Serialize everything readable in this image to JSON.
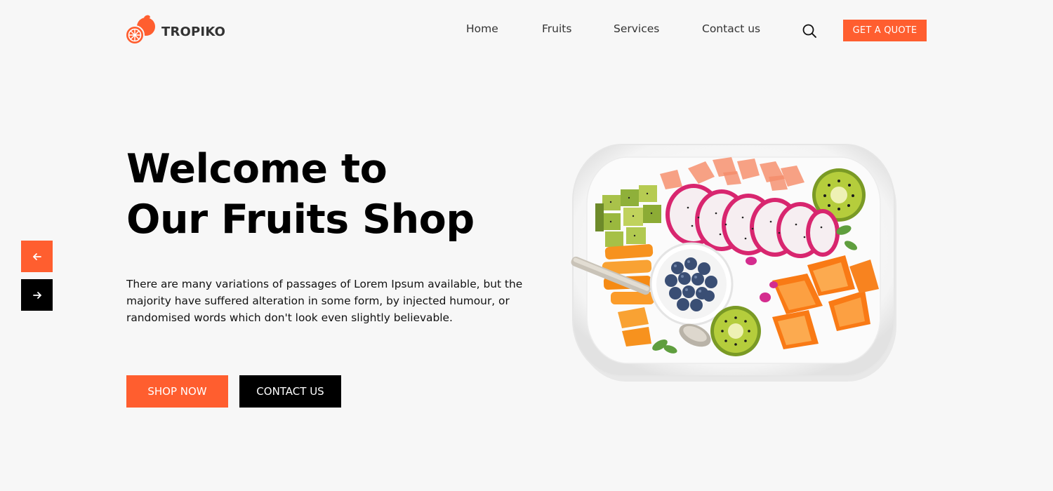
{
  "brand": {
    "name": "TROPIKO",
    "logo_icon": "orange-fruit-icon",
    "accent_color": "#ff5e2f"
  },
  "nav": {
    "items": [
      {
        "label": "Home"
      },
      {
        "label": "Fruits"
      },
      {
        "label": "Services"
      },
      {
        "label": "Contact us"
      }
    ],
    "search_icon": "search-icon",
    "quote_button": "GET A QUOTE"
  },
  "hero": {
    "title_line1": "Welcome to",
    "title_line2": "Our Fruits Shop",
    "description": "There are many variations of passages of Lorem Ipsum available, but the majority have suffered alteration in some form, by injected humour, or randomised words which don't look even slightly believable.",
    "primary_button": "SHOP NOW",
    "secondary_button": "CONTACT US",
    "image": "fruit-platter-image"
  },
  "slider": {
    "prev_icon": "arrow-left-icon",
    "next_icon": "arrow-right-icon"
  }
}
